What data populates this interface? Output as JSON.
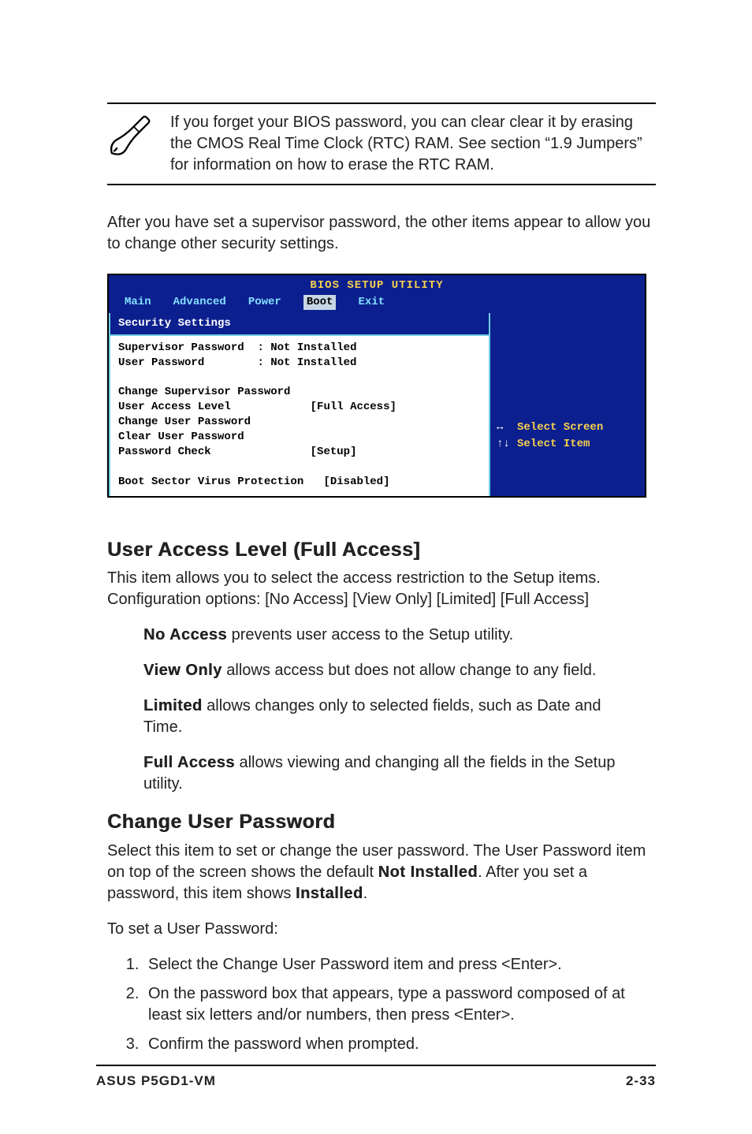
{
  "note": {
    "text": "If you forget your BIOS password, you can clear clear it by erasing the CMOS Real Time Clock (RTC) RAM. See section “1.9 Jumpers” for information on how to erase the RTC RAM."
  },
  "intro": "After you have set a supervisor password, the other items appear to allow you to change other security settings.",
  "bios": {
    "title": "BIOS SETUP UTILITY",
    "tabs": [
      "Main",
      "Advanced",
      "Power",
      "Boot",
      "Exit"
    ],
    "active_tab_index": 3,
    "panel_heading": "Security Settings",
    "status_rows": [
      {
        "label": "Supervisor Password",
        "value": ": Not Installed"
      },
      {
        "label": "User Password",
        "value": ": Not Installed"
      }
    ],
    "action_rows": [
      {
        "label": "Change Supervisor Password",
        "value": ""
      },
      {
        "label": "User Access Level",
        "value": "[Full Access]"
      },
      {
        "label": "Change User Password",
        "value": ""
      },
      {
        "label": "Clear User Password",
        "value": ""
      },
      {
        "label": "Password Check",
        "value": "[Setup]"
      }
    ],
    "extra_row": {
      "label": "Boot Sector Virus Protection",
      "value": "[Disabled]"
    },
    "help": [
      {
        "symbol": "↔",
        "text": "Select Screen"
      },
      {
        "symbol": "↑↓",
        "text": "Select Item"
      }
    ]
  },
  "section1": {
    "heading": "User Access Level (Full Access]",
    "body": "This item allows you to select the access restriction to the Setup items. Configuration options: [No Access] [View Only] [Limited] [Full Access]",
    "defs": [
      {
        "term": "No Access",
        "rest": " prevents user access to the Setup utility."
      },
      {
        "term": "View Only",
        "rest": " allows access but does not allow change to any field."
      },
      {
        "term": "Limited",
        "rest": " allows changes only to selected fields, such as Date and Time."
      },
      {
        "term": "Full Access",
        "rest": " allows viewing and changing all the fields in the Setup utility."
      }
    ]
  },
  "section2": {
    "heading": "Change User Password",
    "p1a": "Select this item to set or change the user password. The User Password item on top of the screen shows the default ",
    "p1b": "Not Installed",
    "p1c": ". After you set a password, this item shows ",
    "p1d": "Installed",
    "p1e": ".",
    "p2": "To set a User Password:",
    "steps": [
      "Select the Change User Password item and press <Enter>.",
      "On the password box that appears, type a password composed of at least six letters and/or numbers, then press <Enter>.",
      "Confirm the password when prompted."
    ]
  },
  "footer": {
    "left": "ASUS P5GD1-VM",
    "right": "2-33"
  }
}
